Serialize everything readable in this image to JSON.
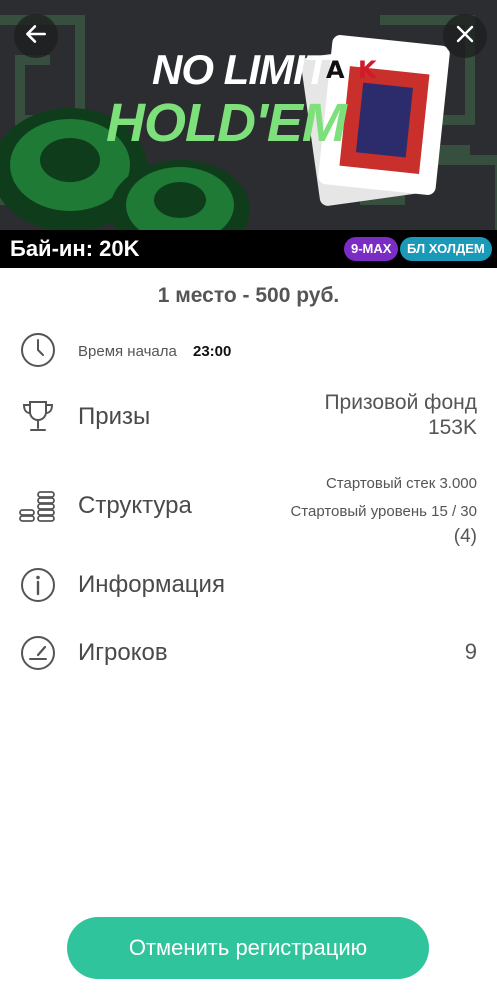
{
  "banner": {
    "title_line1": "NO LIMIT",
    "title_line2": "HOLD'EM",
    "cards": [
      "A",
      "K"
    ],
    "buyin": "Бай-ин: 20K",
    "badges": [
      "9-MAX",
      "БЛ ХОЛДЕМ"
    ]
  },
  "prize_summary": "1 место - 500 руб.",
  "rows": {
    "start_time": {
      "label": "Время начала",
      "value": "23:00"
    },
    "prizes": {
      "label": "Призы",
      "right_line1": "Призовой фонд",
      "right_line2": "153K"
    },
    "structure": {
      "label": "Структура",
      "right_line1": "Стартовый стек 3.000",
      "right_line2": "Стартовый уровень 15 / 30",
      "right_line3": "(4)"
    },
    "info": {
      "label": "Информация"
    },
    "players": {
      "label": "Игроков",
      "value": "9"
    }
  },
  "cta": {
    "label": "Отменить регистрацию"
  },
  "colors": {
    "accent": "#2fc49c",
    "badge_max": "#7b2cc4",
    "badge_type": "#1a9ab8",
    "title_green": "#7ee07a"
  },
  "icons": [
    "back-arrow-icon",
    "close-icon",
    "clock-icon",
    "trophy-icon",
    "chip-stacks-icon",
    "info-icon",
    "speedometer-icon"
  ]
}
